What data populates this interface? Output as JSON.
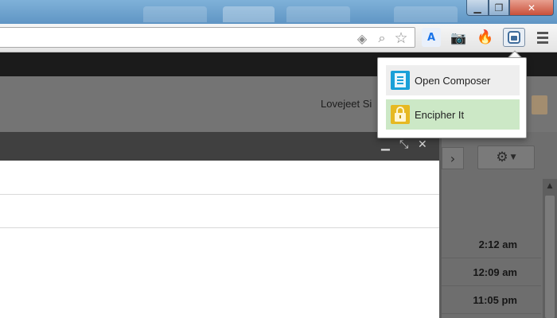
{
  "window": {
    "minimize_glyph": "▁",
    "maximize_glyph": "❐",
    "close_glyph": "✕"
  },
  "toolbar": {
    "address_value": "",
    "extensions": [
      {
        "name": "translate-extension",
        "icon": "translate-icon",
        "glyph": "A"
      },
      {
        "name": "camera-extension",
        "icon": "camera-icon",
        "glyph": "📷"
      },
      {
        "name": "fire-extension",
        "icon": "fire-icon",
        "glyph": "🔥"
      },
      {
        "name": "encipher-extension",
        "icon": "encipher-icon",
        "glyph": ""
      }
    ],
    "omnibox_icons": [
      "extension-diamond-icon",
      "zoom-icon",
      "bookmark-star-icon"
    ]
  },
  "account": {
    "user_name": "Lovejeet Si"
  },
  "composer": {
    "minimize_glyph": "▁",
    "popout_glyph": "⤡",
    "close_glyph": "✕"
  },
  "mail_list": {
    "next_glyph": "›",
    "settings_icon": "gear-icon",
    "times": [
      "2:12 am",
      "12:09 am",
      "11:05 pm"
    ]
  },
  "popup": {
    "items": [
      {
        "label": "Open Composer",
        "icon": "document-icon"
      },
      {
        "label": "Encipher It",
        "icon": "lock-icon"
      }
    ]
  },
  "colors": {
    "titlebar": "#6a9fcb",
    "encipher_highlight": "#cce8c6",
    "composer_header": "#404040"
  }
}
